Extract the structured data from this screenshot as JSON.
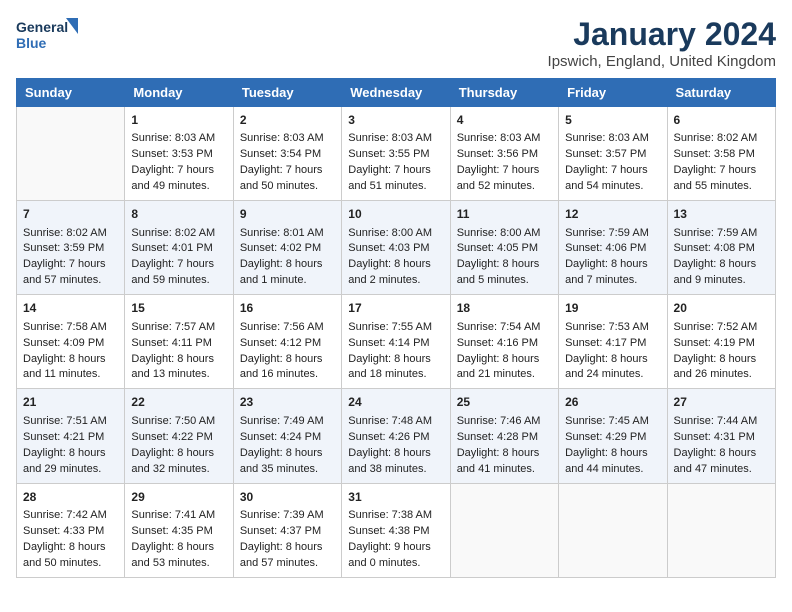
{
  "logo": {
    "line1": "General",
    "line2": "Blue"
  },
  "title": "January 2024",
  "subtitle": "Ipswich, England, United Kingdom",
  "days_header": [
    "Sunday",
    "Monday",
    "Tuesday",
    "Wednesday",
    "Thursday",
    "Friday",
    "Saturday"
  ],
  "weeks": [
    [
      {
        "num": "",
        "content": ""
      },
      {
        "num": "1",
        "content": "Sunrise: 8:03 AM\nSunset: 3:53 PM\nDaylight: 7 hours\nand 49 minutes."
      },
      {
        "num": "2",
        "content": "Sunrise: 8:03 AM\nSunset: 3:54 PM\nDaylight: 7 hours\nand 50 minutes."
      },
      {
        "num": "3",
        "content": "Sunrise: 8:03 AM\nSunset: 3:55 PM\nDaylight: 7 hours\nand 51 minutes."
      },
      {
        "num": "4",
        "content": "Sunrise: 8:03 AM\nSunset: 3:56 PM\nDaylight: 7 hours\nand 52 minutes."
      },
      {
        "num": "5",
        "content": "Sunrise: 8:03 AM\nSunset: 3:57 PM\nDaylight: 7 hours\nand 54 minutes."
      },
      {
        "num": "6",
        "content": "Sunrise: 8:02 AM\nSunset: 3:58 PM\nDaylight: 7 hours\nand 55 minutes."
      }
    ],
    [
      {
        "num": "7",
        "content": "Sunrise: 8:02 AM\nSunset: 3:59 PM\nDaylight: 7 hours\nand 57 minutes."
      },
      {
        "num": "8",
        "content": "Sunrise: 8:02 AM\nSunset: 4:01 PM\nDaylight: 7 hours\nand 59 minutes."
      },
      {
        "num": "9",
        "content": "Sunrise: 8:01 AM\nSunset: 4:02 PM\nDaylight: 8 hours\nand 1 minute."
      },
      {
        "num": "10",
        "content": "Sunrise: 8:00 AM\nSunset: 4:03 PM\nDaylight: 8 hours\nand 2 minutes."
      },
      {
        "num": "11",
        "content": "Sunrise: 8:00 AM\nSunset: 4:05 PM\nDaylight: 8 hours\nand 5 minutes."
      },
      {
        "num": "12",
        "content": "Sunrise: 7:59 AM\nSunset: 4:06 PM\nDaylight: 8 hours\nand 7 minutes."
      },
      {
        "num": "13",
        "content": "Sunrise: 7:59 AM\nSunset: 4:08 PM\nDaylight: 8 hours\nand 9 minutes."
      }
    ],
    [
      {
        "num": "14",
        "content": "Sunrise: 7:58 AM\nSunset: 4:09 PM\nDaylight: 8 hours\nand 11 minutes."
      },
      {
        "num": "15",
        "content": "Sunrise: 7:57 AM\nSunset: 4:11 PM\nDaylight: 8 hours\nand 13 minutes."
      },
      {
        "num": "16",
        "content": "Sunrise: 7:56 AM\nSunset: 4:12 PM\nDaylight: 8 hours\nand 16 minutes."
      },
      {
        "num": "17",
        "content": "Sunrise: 7:55 AM\nSunset: 4:14 PM\nDaylight: 8 hours\nand 18 minutes."
      },
      {
        "num": "18",
        "content": "Sunrise: 7:54 AM\nSunset: 4:16 PM\nDaylight: 8 hours\nand 21 minutes."
      },
      {
        "num": "19",
        "content": "Sunrise: 7:53 AM\nSunset: 4:17 PM\nDaylight: 8 hours\nand 24 minutes."
      },
      {
        "num": "20",
        "content": "Sunrise: 7:52 AM\nSunset: 4:19 PM\nDaylight: 8 hours\nand 26 minutes."
      }
    ],
    [
      {
        "num": "21",
        "content": "Sunrise: 7:51 AM\nSunset: 4:21 PM\nDaylight: 8 hours\nand 29 minutes."
      },
      {
        "num": "22",
        "content": "Sunrise: 7:50 AM\nSunset: 4:22 PM\nDaylight: 8 hours\nand 32 minutes."
      },
      {
        "num": "23",
        "content": "Sunrise: 7:49 AM\nSunset: 4:24 PM\nDaylight: 8 hours\nand 35 minutes."
      },
      {
        "num": "24",
        "content": "Sunrise: 7:48 AM\nSunset: 4:26 PM\nDaylight: 8 hours\nand 38 minutes."
      },
      {
        "num": "25",
        "content": "Sunrise: 7:46 AM\nSunset: 4:28 PM\nDaylight: 8 hours\nand 41 minutes."
      },
      {
        "num": "26",
        "content": "Sunrise: 7:45 AM\nSunset: 4:29 PM\nDaylight: 8 hours\nand 44 minutes."
      },
      {
        "num": "27",
        "content": "Sunrise: 7:44 AM\nSunset: 4:31 PM\nDaylight: 8 hours\nand 47 minutes."
      }
    ],
    [
      {
        "num": "28",
        "content": "Sunrise: 7:42 AM\nSunset: 4:33 PM\nDaylight: 8 hours\nand 50 minutes."
      },
      {
        "num": "29",
        "content": "Sunrise: 7:41 AM\nSunset: 4:35 PM\nDaylight: 8 hours\nand 53 minutes."
      },
      {
        "num": "30",
        "content": "Sunrise: 7:39 AM\nSunset: 4:37 PM\nDaylight: 8 hours\nand 57 minutes."
      },
      {
        "num": "31",
        "content": "Sunrise: 7:38 AM\nSunset: 4:38 PM\nDaylight: 9 hours\nand 0 minutes."
      },
      {
        "num": "",
        "content": ""
      },
      {
        "num": "",
        "content": ""
      },
      {
        "num": "",
        "content": ""
      }
    ]
  ]
}
